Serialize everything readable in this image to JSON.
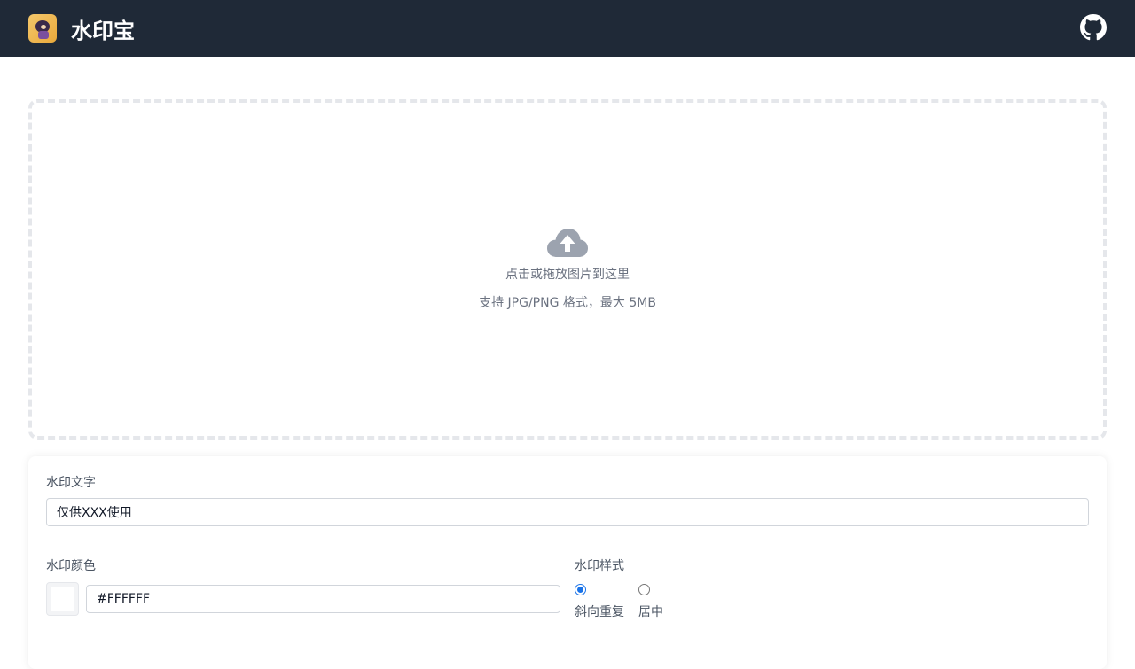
{
  "header": {
    "title": "水印宝",
    "logo_icon": "app-logo",
    "github_icon": "github-icon"
  },
  "upload": {
    "icon": "cloud-upload-icon",
    "main_text": "点击或拖放图片到这里",
    "sub_text": "支持 JPG/PNG 格式，最大 5MB"
  },
  "settings": {
    "text_label": "水印文字",
    "text_value": "仅供XXX使用",
    "color_label": "水印颜色",
    "color_value": "#FFFFFF",
    "style_label": "水印样式",
    "style_options": [
      {
        "label": "斜向重复",
        "checked": true
      },
      {
        "label": "居中",
        "checked": false
      }
    ]
  },
  "colors": {
    "header_bg": "#1f2937",
    "accent": "#1a73e8"
  }
}
